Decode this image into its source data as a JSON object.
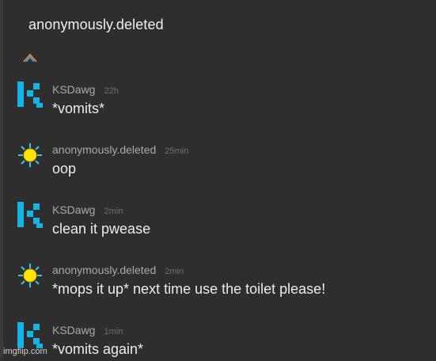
{
  "thread": {
    "title": "anonymously.deleted"
  },
  "messages": [
    {
      "author": "KSDawg",
      "time": "22h",
      "text": "*vomits*",
      "avatar_icon": "ksdawg-logo-icon"
    },
    {
      "author": "anonymously.deleted",
      "time": "25min",
      "text": "oop",
      "avatar_icon": "sun-icon"
    },
    {
      "author": "KSDawg",
      "time": "2min",
      "text": "clean it pwease",
      "avatar_icon": "ksdawg-logo-icon"
    },
    {
      "author": "anonymously.deleted",
      "time": "2min",
      "text": "*mops it up* next time use the toilet please!",
      "avatar_icon": "sun-icon"
    },
    {
      "author": "KSDawg",
      "time": "1min",
      "text": "*vomits again*",
      "avatar_icon": "ksdawg-logo-icon"
    }
  ],
  "watermark": "imgflip.com",
  "colors": {
    "background": "#2e2e2e",
    "author": "#a9a9a9",
    "timestamp": "#6f6f6f",
    "message_text": "#ececec",
    "ksdawg_logo": "#16b4e4",
    "sun": "#ffe500"
  }
}
